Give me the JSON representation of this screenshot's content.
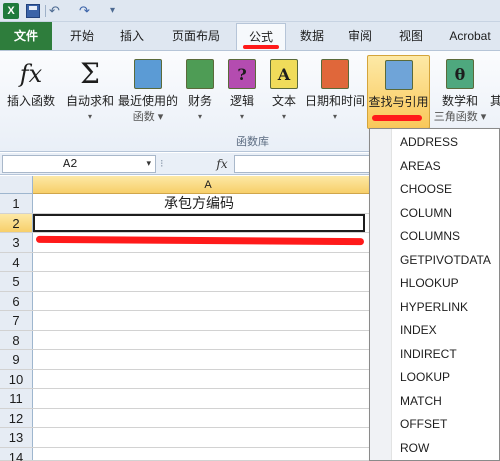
{
  "quick_access": {
    "app_icon_label": "X",
    "undo_glyph": "↶ ▾",
    "redo_glyph": "↷ ▾",
    "more_glyph": "▾"
  },
  "tabs": [
    {
      "label": "文件"
    },
    {
      "label": "开始"
    },
    {
      "label": "插入"
    },
    {
      "label": "页面布局"
    },
    {
      "label": "公式"
    },
    {
      "label": "数据"
    },
    {
      "label": "审阅"
    },
    {
      "label": "视图"
    },
    {
      "label": "Acrobat"
    }
  ],
  "active_tab": "公式",
  "ribbon": {
    "buttons": [
      {
        "label": "插入函数",
        "label2": "",
        "icon": "fx-icon"
      },
      {
        "label": "自动求和",
        "label2": "▾",
        "icon": "sigma-icon"
      },
      {
        "label": "最近使用的",
        "label2": "函数 ▾",
        "icon": "star-book-icon"
      },
      {
        "label": "财务",
        "label2": "▾",
        "icon": "finance-book-icon"
      },
      {
        "label": "逻辑",
        "label2": "▾",
        "icon": "logic-book-icon"
      },
      {
        "label": "文本",
        "label2": "▾",
        "icon": "text-book-icon"
      },
      {
        "label": "日期和时间",
        "label2": "▾",
        "icon": "date-book-icon"
      },
      {
        "label": "查找与引用",
        "label2": "",
        "icon": "lookup-book-icon"
      },
      {
        "label": "数学和",
        "label2": "三角函数 ▾",
        "icon": "math-book-icon"
      },
      {
        "label": "其",
        "label2": "",
        "icon": "more-functions-icon"
      }
    ],
    "icon_glyphs": {
      "fx": "fx",
      "sigma": "Σ",
      "logic": "?",
      "text": "A",
      "math": "θ"
    },
    "group_label": "函数库"
  },
  "formula_bar": {
    "name_box_value": "A2",
    "name_box_arrow": "▾",
    "divider_glyph": "⁝",
    "fx_label": "fx",
    "formula_value": ""
  },
  "sheet": {
    "column_header": "A",
    "rows": [
      {
        "num": "1",
        "a": "承包方编码"
      },
      {
        "num": "2",
        "a": ""
      },
      {
        "num": "3",
        "a": ""
      },
      {
        "num": "4",
        "a": ""
      },
      {
        "num": "5",
        "a": ""
      },
      {
        "num": "6",
        "a": ""
      },
      {
        "num": "7",
        "a": ""
      },
      {
        "num": "8",
        "a": ""
      },
      {
        "num": "9",
        "a": ""
      },
      {
        "num": "10",
        "a": ""
      },
      {
        "num": "11",
        "a": ""
      },
      {
        "num": "12",
        "a": ""
      },
      {
        "num": "13",
        "a": ""
      },
      {
        "num": "14",
        "a": ""
      }
    ],
    "active_cell": "A2"
  },
  "lookup_menu": {
    "items": [
      "ADDRESS",
      "AREAS",
      "CHOOSE",
      "COLUMN",
      "COLUMNS",
      "GETPIVOTDATA",
      "HLOOKUP",
      "HYPERLINK",
      "INDEX",
      "INDIRECT",
      "LOOKUP",
      "MATCH",
      "OFFSET",
      "ROW"
    ]
  },
  "colors": {
    "file_tab": "#2e7d3c",
    "highlight": "#f9c85a",
    "annotation_red": "#ff1a1a"
  }
}
